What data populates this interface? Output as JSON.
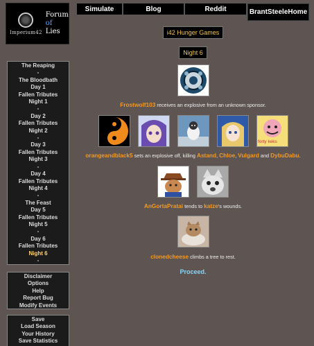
{
  "logo": {
    "left_text": "Imperium42",
    "right_line1": "Forum",
    "right_line2": "of",
    "right_line3": "Lies"
  },
  "topnav": {
    "simulate": "Simulate",
    "blog": "Blog",
    "reddit": "Reddit",
    "home_line1": "BrantSteele",
    "home_line2": "Home"
  },
  "sidebar": {
    "progress": [
      {
        "label": "The Reaping"
      },
      {
        "label": "-"
      },
      {
        "label": "The Bloodbath"
      },
      {
        "label": "Day 1"
      },
      {
        "label": "Fallen Tributes"
      },
      {
        "label": "Night 1"
      },
      {
        "label": "-"
      },
      {
        "label": "Day 2"
      },
      {
        "label": "Fallen Tributes"
      },
      {
        "label": "Night 2"
      },
      {
        "label": "-"
      },
      {
        "label": "Day 3"
      },
      {
        "label": "Fallen Tributes"
      },
      {
        "label": "Night 3"
      },
      {
        "label": "-"
      },
      {
        "label": "Day 4"
      },
      {
        "label": "Fallen Tributes"
      },
      {
        "label": "Night 4"
      },
      {
        "label": "-"
      },
      {
        "label": "The Feast"
      },
      {
        "label": "Day 5"
      },
      {
        "label": "Fallen Tributes"
      },
      {
        "label": "Night 5"
      },
      {
        "label": "-"
      },
      {
        "label": "Day 6"
      },
      {
        "label": "Fallen Tributes"
      },
      {
        "label": "Night 6"
      },
      {
        "label": "-"
      }
    ],
    "current": "Night 6",
    "links": [
      {
        "label": "Disclaimer"
      },
      {
        "label": "Options"
      },
      {
        "label": "Help"
      },
      {
        "label": "Report Bug"
      },
      {
        "label": "Modify Events"
      }
    ],
    "save": [
      {
        "label": "Save"
      },
      {
        "label": "Load Season"
      },
      {
        "label": "Your History"
      },
      {
        "label": "Save Statistics"
      }
    ]
  },
  "main": {
    "game_title": "i42 Hunger Games",
    "phase": "Night 6",
    "events": [
      {
        "names": [
          "Frostwolf103"
        ],
        "text_parts": [
          "",
          " receives an explosive from an unknown sponsor."
        ]
      },
      {
        "names": [
          "orangeandblack5",
          "Astand",
          "Chloe",
          "Vulgard",
          "DybuDabu"
        ],
        "text_parts": [
          "",
          " sets an explosive off, killing ",
          ", ",
          ", ",
          " and ",
          "."
        ]
      },
      {
        "names": [
          "AnGortaPratai",
          "katze"
        ],
        "text_parts": [
          "",
          " tends to ",
          "'s wounds."
        ]
      },
      {
        "names": [
          "clonedcheese"
        ],
        "text_parts": [
          "",
          " climbs a tree to rest."
        ]
      }
    ],
    "forty_keks_caption": "forty keks",
    "proceed": "Proceed."
  },
  "colors": {
    "background": "#5e5452",
    "name_orange": "#f59a1e",
    "title_gold": "#f0c64a",
    "proceed_blue": "#8ad6f7"
  }
}
